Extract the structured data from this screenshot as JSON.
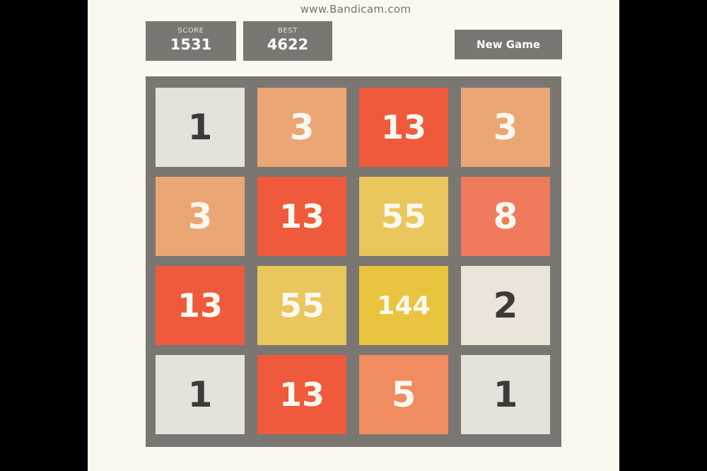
{
  "watermark": "www.Bandicam.com",
  "header": {
    "score_label": "SCORE",
    "score_value": "1531",
    "best_label": "BEST",
    "best_value": "4622",
    "new_game_label": "New Game"
  },
  "board": {
    "rows": 4,
    "cols": 4,
    "tiles": [
      {
        "row": 0,
        "col": 0,
        "value": "1",
        "color": "#e6e1da"
      },
      {
        "row": 0,
        "col": 1,
        "value": "3",
        "color": "#eba676"
      },
      {
        "row": 0,
        "col": 2,
        "value": "13",
        "color": "#ee5a3b"
      },
      {
        "row": 0,
        "col": 3,
        "value": "3",
        "color": "#eba676"
      },
      {
        "row": 1,
        "col": 0,
        "value": "3",
        "color": "#eba676"
      },
      {
        "row": 1,
        "col": 1,
        "value": "13",
        "color": "#ee5a3b"
      },
      {
        "row": 1,
        "col": 2,
        "value": "55",
        "color": "#e9c75c"
      },
      {
        "row": 1,
        "col": 3,
        "value": "8",
        "color": "#ef7a5c"
      },
      {
        "row": 2,
        "col": 0,
        "value": "13",
        "color": "#ee5a3b"
      },
      {
        "row": 2,
        "col": 1,
        "value": "55",
        "color": "#e9c75c"
      },
      {
        "row": 2,
        "col": 2,
        "value": "144",
        "color": "#e9c43f"
      },
      {
        "row": 2,
        "col": 3,
        "value": "2",
        "color": "#ebe4d8"
      },
      {
        "row": 3,
        "col": 0,
        "value": "1",
        "color": "#e6e1da"
      },
      {
        "row": 3,
        "col": 1,
        "value": "13",
        "color": "#ee5a3b"
      },
      {
        "row": 3,
        "col": 2,
        "value": "5",
        "color": "#f08c5f"
      },
      {
        "row": 3,
        "col": 3,
        "value": "1",
        "color": "#e6e1da"
      }
    ]
  }
}
